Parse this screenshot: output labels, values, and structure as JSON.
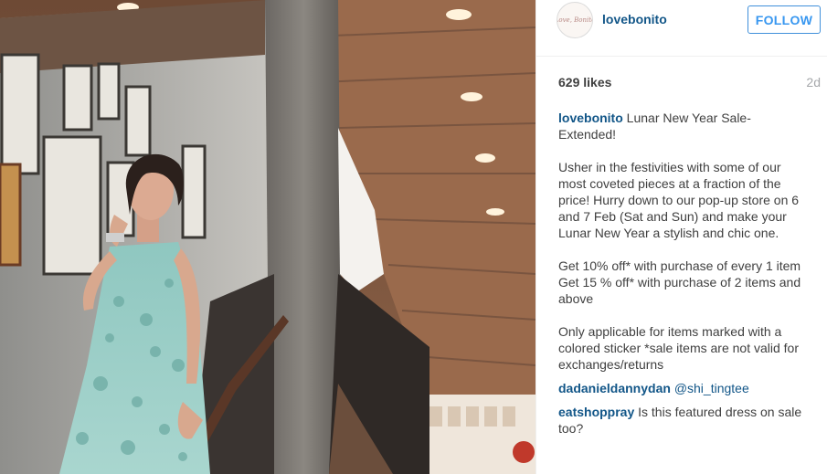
{
  "post": {
    "username": "lovebonito",
    "avatar_text": "Love, Bonito",
    "follow_label": "FOLLOW",
    "likes": "629 likes",
    "age": "2d"
  },
  "caption": {
    "author": "lovebonito",
    "title": "Lunar New Year Sale- Extended!",
    "para1": "Usher in the festivities with some of our most coveted pieces at a fraction of the price! Hurry down to our pop-up store on 6 and 7 Feb (Sat and Sun) and make your Lunar New Year a stylish and chic one.",
    "offer1": "Get 10% off* with purchase of every 1 item",
    "offer2": "Get 15 % off* with purchase of 2 items and above",
    "terms": "Only applicable for items marked with a colored sticker *sale items are not valid for exchanges/returns"
  },
  "comments": [
    {
      "user": "dadanieldannydan",
      "text": "@shi_tingtee"
    },
    {
      "user": "eatshoppray",
      "text": "Is this featured dress on sale too?"
    }
  ],
  "colors": {
    "link": "#125688",
    "follow": "#3897f0",
    "text": "#3f3f3f",
    "muted": "#a5a7aa"
  }
}
